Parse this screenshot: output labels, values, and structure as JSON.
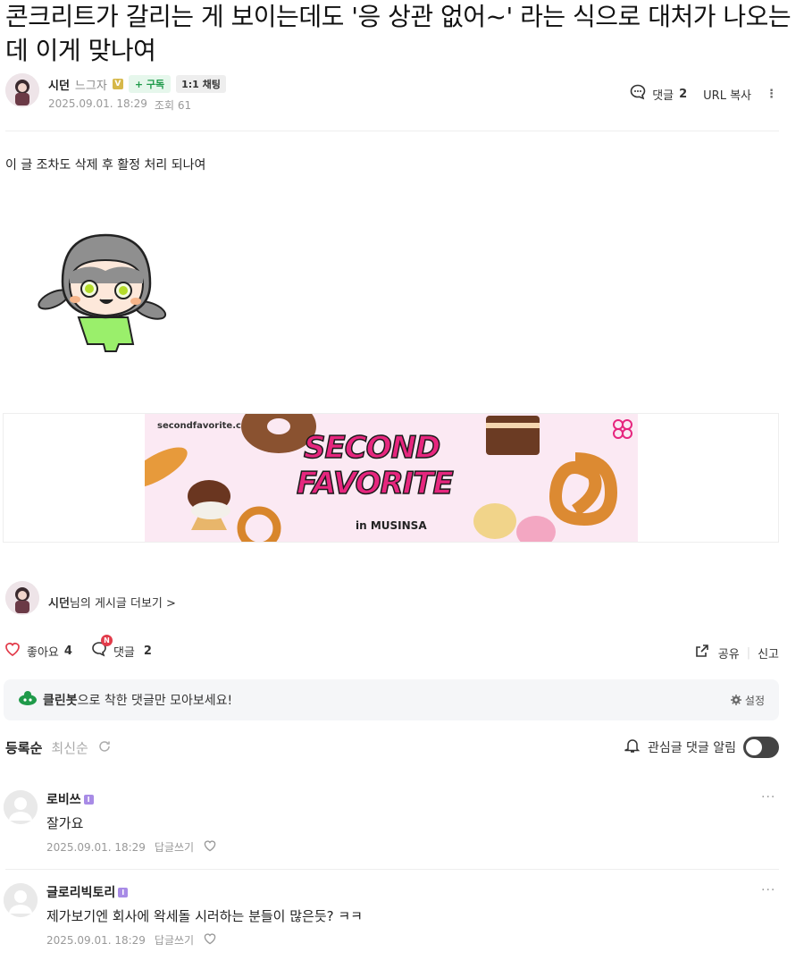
{
  "post": {
    "title": "콘크리트가 갈리는 게 보이는데도 '응 상관 없어~' 라는 식으로 대처가 나오는데 이게 맞나여",
    "author": "시던",
    "level": "느그자",
    "level_badge": "V",
    "subscribe_label": "+ 구독",
    "chat_label": "1:1 채팅",
    "date": "2025.09.01. 18:29",
    "views": "조회 61",
    "comment_label": "댓글",
    "comment_count": "2",
    "url_copy": "URL 복사",
    "body": "이 글 조차도 삭제 후 활정 처리 되나여"
  },
  "banner": {
    "site": "secondfavorite.co.kr",
    "line1": "SECOND",
    "line2": "FAVORITE",
    "sub": "in MUSINSA"
  },
  "more": {
    "author": "시던",
    "suffix": "님의 게시글 더보기 >"
  },
  "reactions": {
    "like_label": "좋아요",
    "like_count": "4",
    "comment_label": "댓글",
    "comment_count": "2",
    "new_badge": "N",
    "share": "공유",
    "report": "신고"
  },
  "cleanbot": {
    "brand": "클린봇",
    "text": "으로 착한 댓글만 모아보세요!",
    "settings": "설정"
  },
  "sort": {
    "registered": "등록순",
    "latest": "최신순",
    "alarm": "관심글 댓글 알림"
  },
  "comments": [
    {
      "name": "로비쓰",
      "badge": "I",
      "text": "잘가요",
      "date": "2025.09.01. 18:29",
      "reply": "답글쓰기"
    },
    {
      "name": "글로리빅토리",
      "badge": "I",
      "text": "제가보기엔 회사에 왁세돌 시러하는 분들이 많은듯? ㅋㅋ",
      "date": "2025.09.01. 18:29",
      "reply": "답글쓰기"
    }
  ],
  "colors": {
    "accent_green": "#1f9a4a",
    "banner_pink": "#e6267e",
    "like_red": "#e23b4a"
  }
}
